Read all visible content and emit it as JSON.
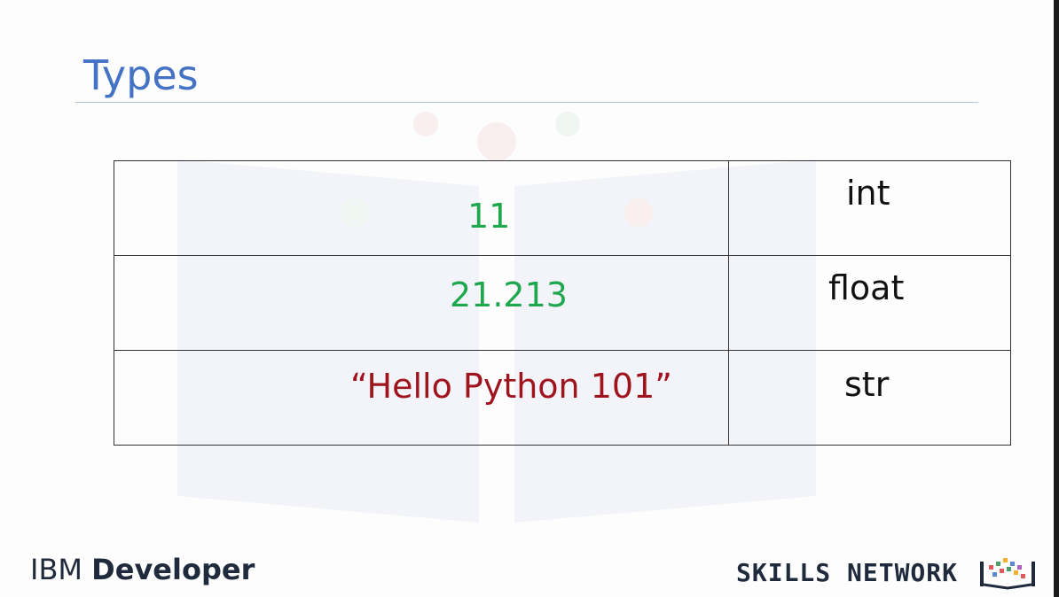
{
  "slide": {
    "title": "Types",
    "rows": [
      {
        "value": "11",
        "type": "int",
        "value_color": "#1fa74e"
      },
      {
        "value": "21.213",
        "type": "float",
        "value_color": "#1fa74e"
      },
      {
        "value": "“Hello Python 101”",
        "type": "str",
        "value_color": "#a0141e"
      }
    ]
  },
  "footer": {
    "brand_left_light": "IBM ",
    "brand_left_bold": "Developer",
    "brand_right": "SKILLS NETWORK",
    "brand_right_icon": "skills-network-logo-icon"
  },
  "colors": {
    "title": "#4472c4",
    "text": "#111111",
    "footer": "#1f2b3d"
  }
}
